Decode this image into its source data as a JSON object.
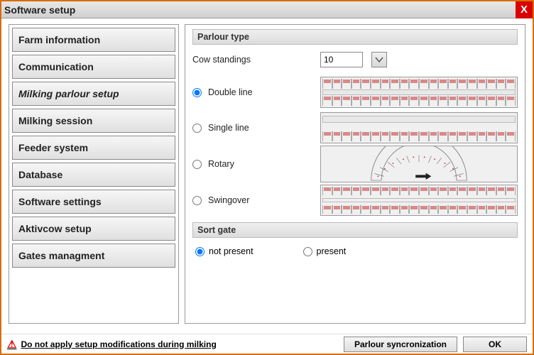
{
  "window": {
    "title": "Software setup"
  },
  "nav": {
    "items": [
      {
        "label": "Farm information"
      },
      {
        "label": "Communication"
      },
      {
        "label": "Milking parlour setup",
        "active": true
      },
      {
        "label": "Milking session"
      },
      {
        "label": "Feeder system"
      },
      {
        "label": "Database"
      },
      {
        "label": "Software settings"
      },
      {
        "label": "Aktivcow setup"
      },
      {
        "label": "Gates managment"
      }
    ]
  },
  "main": {
    "section_parlour_type": "Parlour type",
    "cow_standings_label": "Cow standings",
    "cow_standings_value": "10",
    "options": {
      "double_line": "Double line",
      "single_line": "Single line",
      "rotary": "Rotary",
      "swingover": "Swingover"
    },
    "section_sort_gate": "Sort gate",
    "sort_gate": {
      "not_present": "not present",
      "present": "present"
    }
  },
  "footer": {
    "warning": "Do not apply setup modifications during milking",
    "parlour_sync": "Parlour syncronization",
    "ok": "OK"
  }
}
